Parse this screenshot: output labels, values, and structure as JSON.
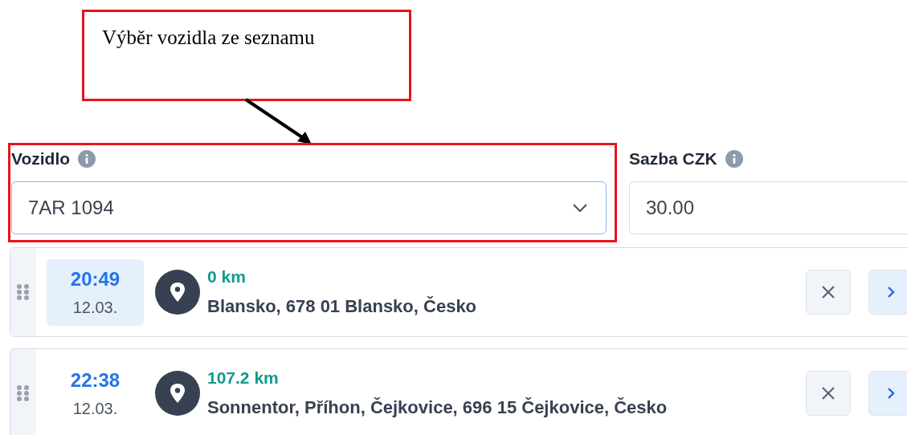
{
  "annotation": {
    "text": "Výběr vozidla ze seznamu"
  },
  "fields": [
    {
      "label": "Vozidlo",
      "kind": "select",
      "value": "7AR 1094",
      "focused": true
    },
    {
      "label": "Sazba CZK",
      "kind": "input",
      "value": "30.00",
      "focused": false
    }
  ],
  "stops": [
    {
      "time": "20:49",
      "date": "12.03.",
      "selected": true,
      "distance": "0 km",
      "address": "Blansko, 678 01 Blansko, Česko"
    },
    {
      "time": "22:38",
      "date": "12.03.",
      "selected": false,
      "distance": "107.2 km",
      "address": "Sonnentor, Příhon, Čejkovice, 696 15 Čejkovice, Česko"
    }
  ]
}
